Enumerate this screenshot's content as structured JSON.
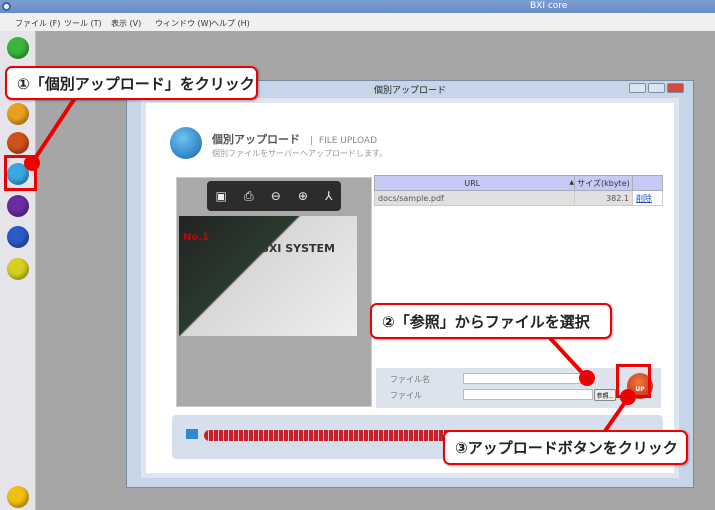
{
  "app": {
    "title": "BXI core"
  },
  "menu": [
    "ファイル (F)",
    "ツール (T)",
    "表示 (V)",
    "ウィンドウ (W)",
    "ヘルプ (H)"
  ],
  "dialog": {
    "title": "個別アップロード"
  },
  "header": {
    "title": "個別アップロード",
    "separator": "|",
    "title_en": "FILE UPLOAD",
    "subtitle": "個別ファイルをサーバーへアップロードします。",
    "icon_label": "個別アップ"
  },
  "preview": {
    "toolbar_icons": [
      "save-icon",
      "print-icon",
      "zoom-out-icon",
      "zoom-in-icon",
      "acrobat-icon"
    ],
    "doc_logo": "BXI SYSTEM",
    "doc_text": "No.1"
  },
  "table": {
    "columns": [
      "URL",
      "サイズ(kbyte)",
      ""
    ],
    "sort_indicator": "▲",
    "rows": [
      {
        "url": "docs/sample.pdf",
        "size": "382.1",
        "action": "削除"
      }
    ]
  },
  "form": {
    "filename_label": "ファイル名",
    "file_label": "ファイル",
    "browse_label": "参照...",
    "upload_label": "UP",
    "filename_value": "",
    "file_value": ""
  },
  "progress": {
    "value_percent": 100
  },
  "callouts": {
    "step1": "①「個別アップロード」をクリック",
    "step2": "②「参照」からファイルを選択",
    "step3": "③アップロードボタンをクリック"
  },
  "colors": {
    "accent": "#e00000",
    "titlebar": "#6a8cc6",
    "table_header": "#c7caf5"
  }
}
